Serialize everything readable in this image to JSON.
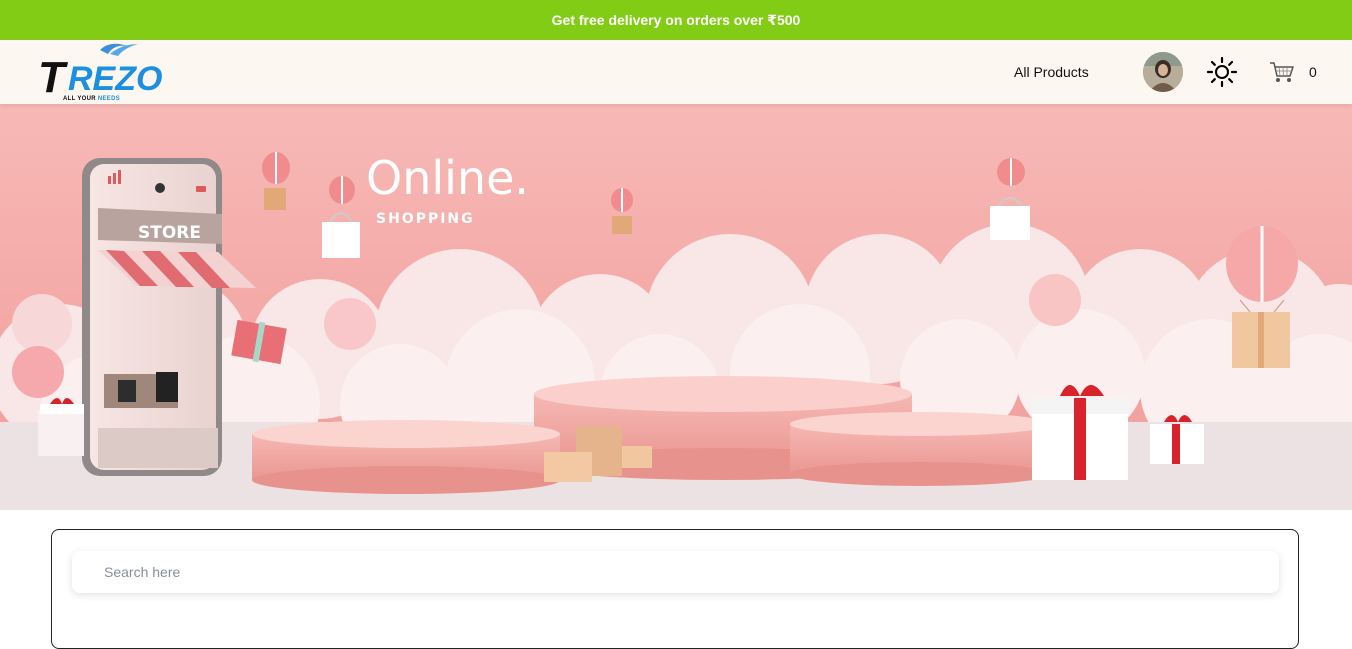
{
  "promo": {
    "text": "Get free delivery on orders over ₹500"
  },
  "brand": {
    "name": "TREZO",
    "tagline_main": "ALL YOUR ",
    "tagline_accent": "NEEDS"
  },
  "nav": {
    "all_products": "All Products",
    "cart_count": "0"
  },
  "hero": {
    "headline": "Online.",
    "subhead": "SHOPPING",
    "store_sign": "STORE"
  },
  "search": {
    "placeholder": "Search here",
    "value": ""
  },
  "colors": {
    "promo_bg": "#83cc16",
    "nav_bg": "#fdf7f2",
    "hero_pink": "#f4a9a8"
  },
  "icons": {
    "theme": "sun-icon",
    "cart": "cart-icon"
  }
}
